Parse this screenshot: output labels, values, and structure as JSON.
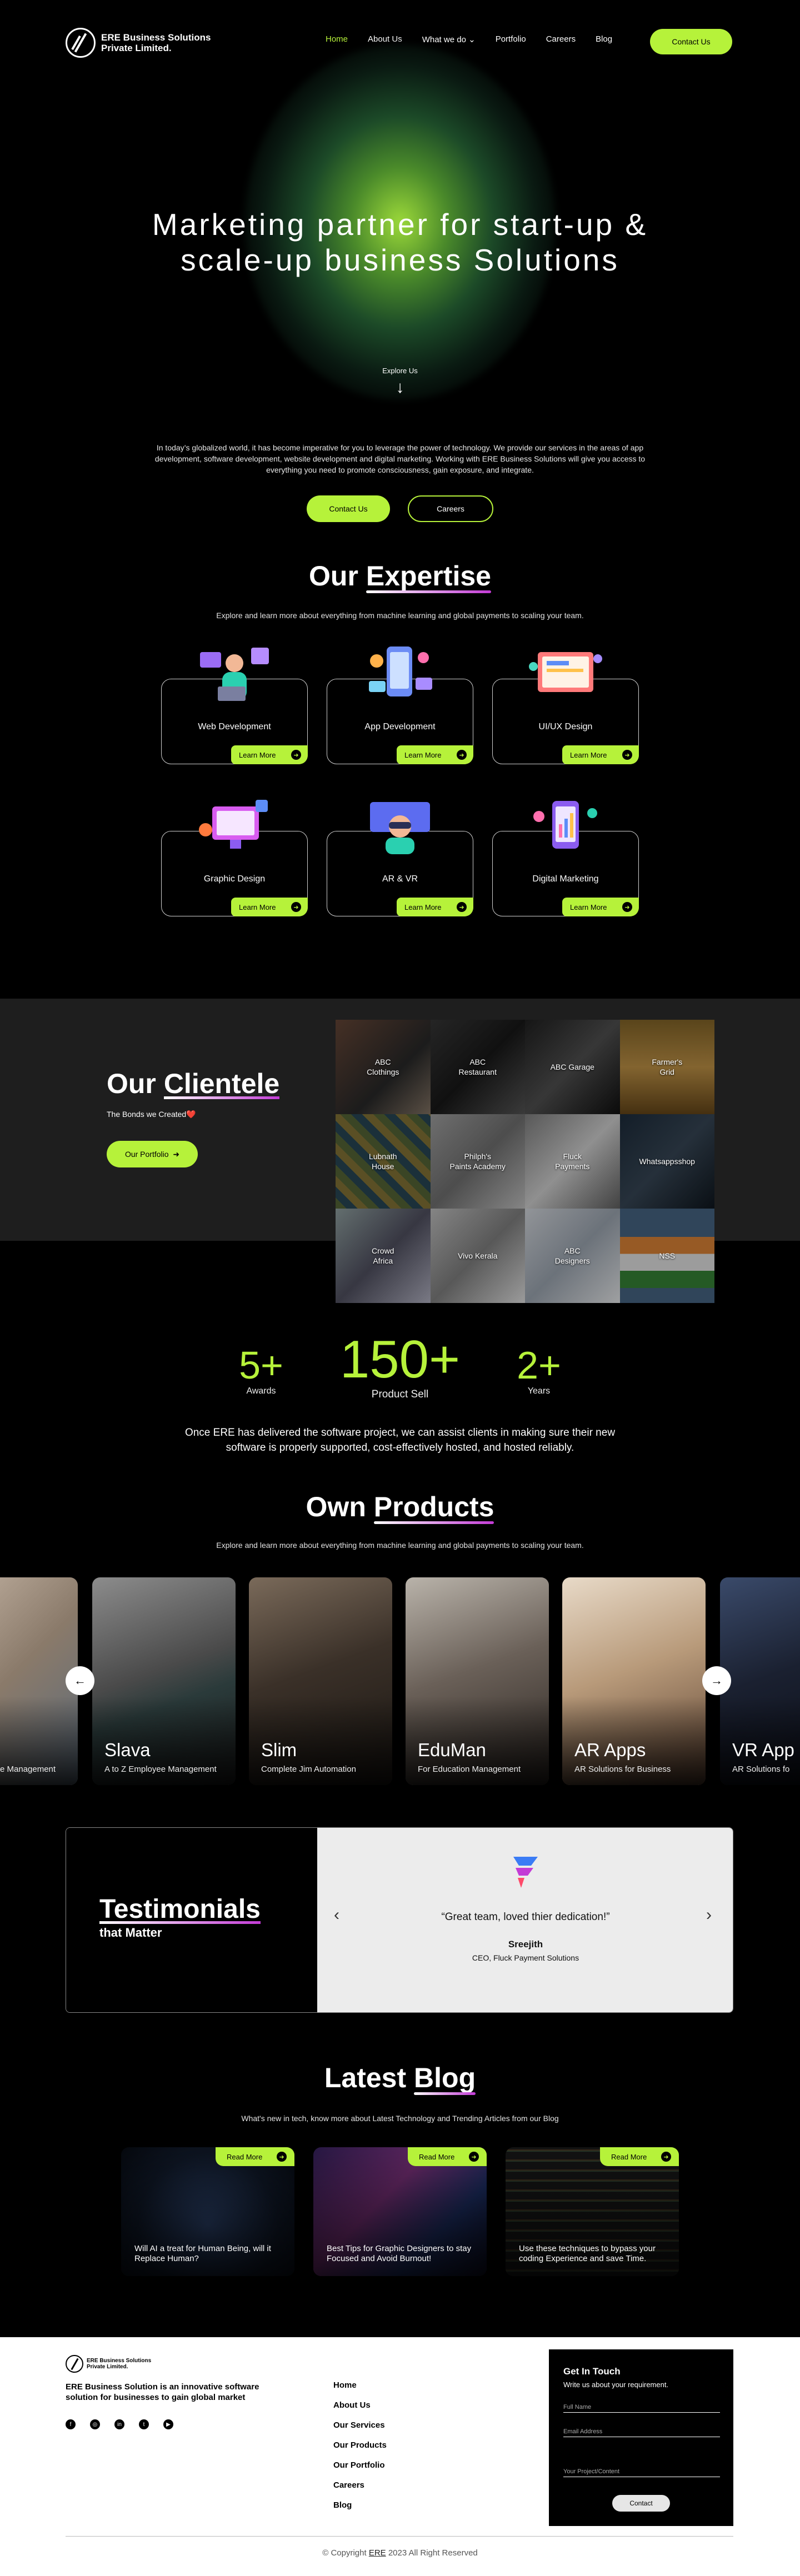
{
  "nav": {
    "logo_line1": "ERE Business Solutions",
    "logo_line2": "Private Limited.",
    "items": [
      "Home",
      "About Us",
      "What we do",
      "Portfolio",
      "Careers",
      "Blog"
    ],
    "dropdown_icon": "chevron-down-icon",
    "contact": "Contact Us"
  },
  "hero": {
    "title_line1": "Marketing partner for start-up &",
    "title_line2": "scale-up business Solutions",
    "explore": "Explore Us",
    "description": "In today’s globalized world, it has become imperative for you to leverage the power of technology. We provide our services in the areas of app development, software development, website development and digital marketing. Working with ERE Business Solutions will give you access to everything you need to promote consciousness, gain exposure, and integrate.",
    "btn_contact": "Contact Us",
    "btn_careers": "Careers"
  },
  "expertise": {
    "title_plain": "Our",
    "title_ul": "Expertise",
    "subtitle": "Explore and learn more about everything from machine learning and global payments to scaling your team.",
    "learn_more": "Learn More",
    "cards": [
      {
        "label": "Web Development"
      },
      {
        "label": "App Development"
      },
      {
        "label": "UI/UX Design"
      },
      {
        "label": "Graphic Design"
      },
      {
        "label": "AR & VR"
      },
      {
        "label": "Digital Marketing"
      }
    ]
  },
  "clientele": {
    "title_plain": "Our",
    "title_ul": "Clientele",
    "subtitle": "The Bonds we Created❤️",
    "button": "Our Portfolio",
    "tiles": [
      {
        "l1": "ABC",
        "l2": "Clothings"
      },
      {
        "l1": "ABC",
        "l2": "Restaurant"
      },
      {
        "l1": "ABC Garage",
        "l2": ""
      },
      {
        "l1": "Farmer's",
        "l2": "Grid"
      },
      {
        "l1": "Lubnath",
        "l2": "House"
      },
      {
        "l1": "Philph's",
        "l2": "Paints Academy"
      },
      {
        "l1": "Fluck",
        "l2": "Payments"
      },
      {
        "l1": "Whatsappsshop",
        "l2": ""
      },
      {
        "l1": "Crowd",
        "l2": "Africa"
      },
      {
        "l1": "Vivo Kerala",
        "l2": ""
      },
      {
        "l1": "ABC",
        "l2": "Designers"
      },
      {
        "l1": "NSS",
        "l2": ""
      }
    ]
  },
  "stats": {
    "items": [
      {
        "num": "5+",
        "label": "Awards"
      },
      {
        "num": "150+",
        "label": "Product Sell"
      },
      {
        "num": "2+",
        "label": "Years"
      }
    ],
    "description": "Once ERE has delivered the software project, we can assist clients in making sure their new software is properly supported, cost-effectively hosted, and hosted reliably."
  },
  "products": {
    "title_plain": "Own",
    "title_ul": "Products",
    "subtitle": "Explore and learn more about everything from machine learning and global payments to scaling your team.",
    "items": [
      {
        "name": "",
        "tag": "e Management"
      },
      {
        "name": "Slava",
        "tag": "A to Z Employee Management"
      },
      {
        "name": "Slim",
        "tag": "Complete Jim Automation"
      },
      {
        "name": "EduMan",
        "tag": "For Education Management"
      },
      {
        "name": "AR Apps",
        "tag": "AR Solutions for Business"
      },
      {
        "name": "VR App",
        "tag": "AR Solutions fo"
      }
    ]
  },
  "testimonials": {
    "title": "Testimonials",
    "subtitle": "that Matter",
    "quote": "“Great team, loved thier dedication!”",
    "author": "Sreejith",
    "role": "CEO, Fluck Payment Solutions"
  },
  "blog": {
    "title_plain": "Latest",
    "title_ul": "Blog",
    "subtitle": "What's new in tech, know more about Latest Technology and Trending Articles from our Blog",
    "read_more": "Read More",
    "posts": [
      {
        "title": "Will AI a treat for Human Being, will it Replace Human?"
      },
      {
        "title": "Best Tips for Graphic Designers to stay Focused and Avoid Burnout!"
      },
      {
        "title": "Use these techniques to bypass your coding Experience and save Time."
      }
    ]
  },
  "footer": {
    "logo_line1": "ERE Business Solutions",
    "logo_line2": "Private Limited.",
    "description": "ERE Business Solution is an innovative software solution for businesses to gain global market",
    "social": [
      "facebook-icon",
      "instagram-icon",
      "linkedin-icon",
      "twitter-icon",
      "youtube-icon"
    ],
    "links": [
      "Home",
      "About Us",
      "Our Services",
      "Our Products",
      "Our Portfolio",
      "Careers",
      "Blog"
    ],
    "form_title": "Get In Touch",
    "form_sub": "Write us about your requirement.",
    "ph_name": "Full Name",
    "ph_email": "Email Address",
    "ph_project": "Your Project/Content",
    "send": "Contact",
    "copy_pre": "© Copyright",
    "copy_brand": "ERE",
    "copy_post": "2023 All Right Reserved"
  }
}
